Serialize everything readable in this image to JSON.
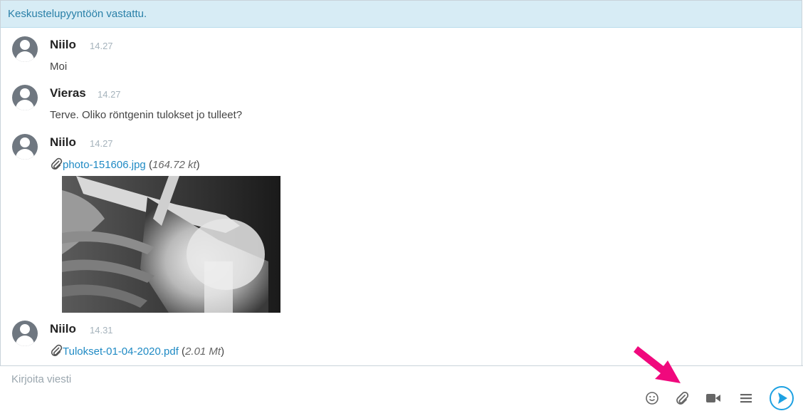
{
  "banner": {
    "text": "Keskustelupyyntöön vastattu."
  },
  "messages": [
    {
      "author": "Niilo",
      "time": "14.27",
      "text": "Moi"
    },
    {
      "author": "Vieras",
      "time": "14.27",
      "text": "Terve. Oliko röntgenin tulokset jo tulleet?"
    },
    {
      "author": "Niilo",
      "time": "14.27",
      "attachment": {
        "file": "photo-151606.jpg",
        "size": "164.72 kt"
      }
    },
    {
      "author": "Niilo",
      "time": "14.31",
      "attachment": {
        "file": "Tulokset-01-04-2020.pdf",
        "size": "2.01 Mt"
      }
    }
  ],
  "composer": {
    "placeholder": "Kirjoita viesti",
    "tools": [
      "emoji-icon",
      "paperclip-icon",
      "video-camera-icon",
      "menu-icon"
    ],
    "send_icon": "send-icon"
  },
  "colors": {
    "accent": "#1da1e2",
    "banner_bg": "#d7ecf5",
    "link": "#1f8ac4",
    "highlight_arrow": "#f0097d"
  }
}
